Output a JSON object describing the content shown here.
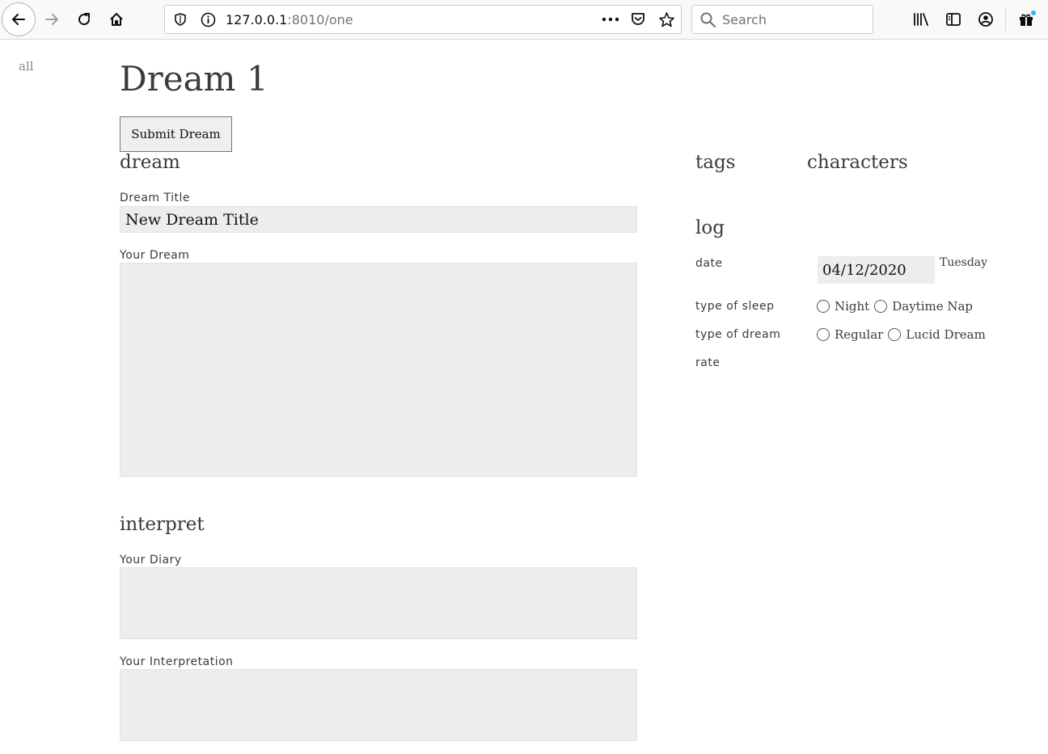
{
  "browser": {
    "url_host": "127.0.0.1",
    "url_rest": ":8010/one",
    "search_placeholder": "Search"
  },
  "nav": {
    "all_link": "all"
  },
  "page": {
    "title": "Dream 1",
    "submit_label": "Submit Dream"
  },
  "dream": {
    "heading": "dream",
    "title_label": "Dream Title",
    "title_value": "New Dream Title",
    "body_label": "Your Dream"
  },
  "interpret": {
    "heading": "interpret",
    "diary_label": "Your Diary",
    "interpretation_label": "Your Interpretation"
  },
  "side": {
    "tags_heading": "tags",
    "characters_heading": "characters"
  },
  "log": {
    "heading": "log",
    "date_label": "date",
    "date_value": "04/12/2020",
    "weekday": "Tuesday",
    "sleep_label": "type of sleep",
    "sleep_options": [
      "Night",
      "Daytime Nap"
    ],
    "dream_type_label": "type of dream",
    "dream_type_options": [
      "Regular",
      "Lucid Dream"
    ],
    "rate_label": "rate"
  }
}
